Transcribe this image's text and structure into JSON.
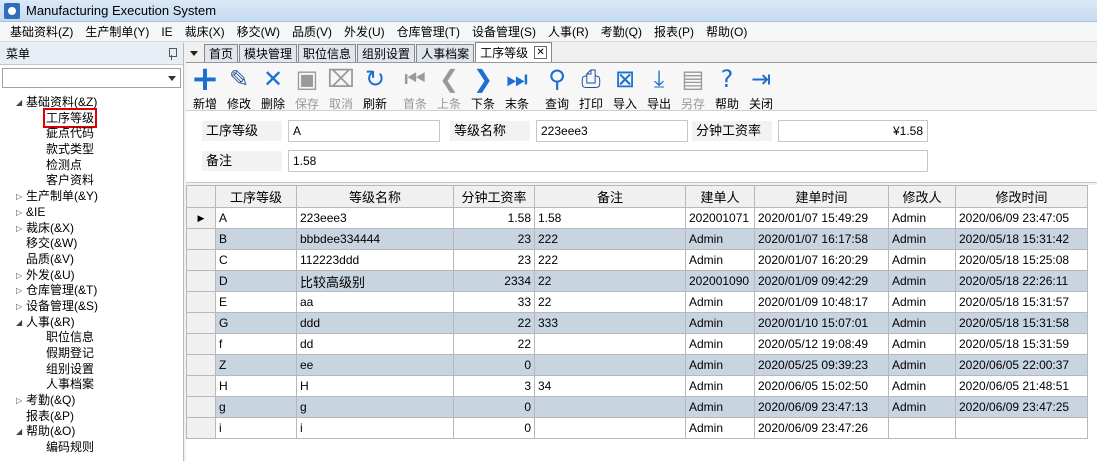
{
  "window": {
    "title": "Manufacturing Execution System"
  },
  "menu": [
    "基础资料(Z)",
    "生产制单(Y)",
    "IE",
    "裁床(X)",
    "移交(W)",
    "品质(V)",
    "外发(U)",
    "仓库管理(T)",
    "设备管理(S)",
    "人事(R)",
    "考勤(Q)",
    "报表(P)",
    "帮助(O)"
  ],
  "sidebar": {
    "title": "菜单",
    "tree": [
      {
        "label": "基础资料(&Z)",
        "level": 0,
        "expander": "◢"
      },
      {
        "label": "工序等级",
        "level": 1,
        "selected": true
      },
      {
        "label": "疵点代码",
        "level": 1
      },
      {
        "label": "款式类型",
        "level": 1
      },
      {
        "label": "检测点",
        "level": 1
      },
      {
        "label": "客户资料",
        "level": 1
      },
      {
        "label": "生产制单(&Y)",
        "level": 0,
        "expander": "▷"
      },
      {
        "label": "&IE",
        "level": 0,
        "expander": "▷"
      },
      {
        "label": "裁床(&X)",
        "level": 0,
        "expander": "▷"
      },
      {
        "label": "移交(&W)",
        "level": 0,
        "expander": ""
      },
      {
        "label": "品质(&V)",
        "level": 0,
        "expander": ""
      },
      {
        "label": "外发(&U)",
        "level": 0,
        "expander": "▷"
      },
      {
        "label": "仓库管理(&T)",
        "level": 0,
        "expander": "▷"
      },
      {
        "label": "设备管理(&S)",
        "level": 0,
        "expander": "▷"
      },
      {
        "label": "人事(&R)",
        "level": 0,
        "expander": "◢"
      },
      {
        "label": "职位信息",
        "level": 1
      },
      {
        "label": "假期登记",
        "level": 1
      },
      {
        "label": "组别设置",
        "level": 1
      },
      {
        "label": "人事档案",
        "level": 1
      },
      {
        "label": "考勤(&Q)",
        "level": 0,
        "expander": "▷"
      },
      {
        "label": "报表(&P)",
        "level": 0,
        "expander": ""
      },
      {
        "label": "帮助(&O)",
        "level": 0,
        "expander": "◢"
      },
      {
        "label": "编码规则",
        "level": 1
      }
    ]
  },
  "tabs": [
    {
      "label": "首页",
      "active": false
    },
    {
      "label": "模块管理",
      "active": false
    },
    {
      "label": "职位信息",
      "active": false
    },
    {
      "label": "组别设置",
      "active": false
    },
    {
      "label": "人事档案",
      "active": false
    },
    {
      "label": "工序等级",
      "active": true
    }
  ],
  "toolbar": [
    {
      "name": "add",
      "label": "新增",
      "glyph": "+",
      "color": "#1a6fd0",
      "disabled": false
    },
    {
      "name": "edit",
      "label": "修改",
      "glyph": "✎",
      "color": "#3060a0",
      "disabled": false
    },
    {
      "name": "delete",
      "label": "删除",
      "glyph": "✕",
      "color": "#1a6fd0",
      "disabled": false
    },
    {
      "name": "save",
      "label": "保存",
      "glyph": "▣",
      "color": "#999999",
      "disabled": true
    },
    {
      "name": "cancel",
      "label": "取消",
      "glyph": "⌧",
      "color": "#999999",
      "disabled": true
    },
    {
      "name": "refresh",
      "label": "刷新",
      "glyph": "↻",
      "color": "#1a6fd0",
      "disabled": false
    },
    {
      "name": "first",
      "label": "首条",
      "glyph": "⏮",
      "color": "#999999",
      "disabled": true
    },
    {
      "name": "prev",
      "label": "上条",
      "glyph": "❮",
      "color": "#999999",
      "disabled": true
    },
    {
      "name": "next",
      "label": "下条",
      "glyph": "❯",
      "color": "#1a6fd0",
      "disabled": false
    },
    {
      "name": "last",
      "label": "末条",
      "glyph": "⏭",
      "color": "#1a6fd0",
      "disabled": false
    },
    {
      "name": "query",
      "label": "查询",
      "glyph": "⚲",
      "color": "#1a6fd0",
      "disabled": false
    },
    {
      "name": "print",
      "label": "打印",
      "glyph": "⎙",
      "color": "#1a4f9a",
      "disabled": false
    },
    {
      "name": "import",
      "label": "导入",
      "glyph": "⊠",
      "color": "#1a6fd0",
      "disabled": false
    },
    {
      "name": "export",
      "label": "导出",
      "glyph": "⤓",
      "color": "#1a6fd0",
      "disabled": false
    },
    {
      "name": "saveas",
      "label": "另存",
      "glyph": "▤",
      "color": "#999999",
      "disabled": true
    },
    {
      "name": "help",
      "label": "帮助",
      "glyph": "?",
      "color": "#1a6fd0",
      "disabled": false
    },
    {
      "name": "close",
      "label": "关闭",
      "glyph": "⇥",
      "color": "#1a6fd0",
      "disabled": false
    }
  ],
  "form": {
    "grade_label": "工序等级",
    "grade_value": "A",
    "name_label": "等级名称",
    "name_value": "223eee3",
    "wage_label": "分钟工资率",
    "wage_value": "¥1.58",
    "remark_label": "备注",
    "remark_value": "1.58"
  },
  "grid": {
    "columns": [
      "工序等级",
      "等级名称",
      "分钟工资率",
      "备注",
      "建单人",
      "建单时间",
      "修改人",
      "修改时间"
    ],
    "rows": [
      [
        "A",
        "223eee3",
        "1.58",
        "1.58",
        "202001071",
        "2020/01/07 15:49:29",
        "Admin",
        "2020/06/09 23:47:05"
      ],
      [
        "B",
        "bbbdee334444",
        "23",
        "222",
        "Admin",
        "2020/01/07 16:17:58",
        "Admin",
        "2020/05/18 15:31:42"
      ],
      [
        "C",
        "112223ddd",
        "23",
        "222",
        "Admin",
        "2020/01/07 16:20:29",
        "Admin",
        "2020/05/18 15:25:08"
      ],
      [
        "D",
        "比较高级别",
        "2334",
        "22",
        "202001090",
        "2020/01/09 09:42:29",
        "Admin",
        "2020/05/18 22:26:11"
      ],
      [
        "E",
        "aa",
        "33",
        "22",
        "Admin",
        "2020/01/09 10:48:17",
        "Admin",
        "2020/05/18 15:31:57"
      ],
      [
        "G",
        "ddd",
        "22",
        "333",
        "Admin",
        "2020/01/10 15:07:01",
        "Admin",
        "2020/05/18 15:31:58"
      ],
      [
        "f",
        "dd",
        "22",
        "",
        "Admin",
        "2020/05/12 19:08:49",
        "Admin",
        "2020/05/18 15:31:59"
      ],
      [
        "Z",
        "ee",
        "0",
        "",
        "Admin",
        "2020/05/25 09:39:23",
        "Admin",
        "2020/06/05 22:00:37"
      ],
      [
        "H",
        "H",
        "3",
        "34",
        "Admin",
        "2020/06/05 15:02:50",
        "Admin",
        "2020/06/05 21:48:51"
      ],
      [
        "g",
        "g",
        "0",
        "",
        "Admin",
        "2020/06/09 23:47:13",
        "Admin",
        "2020/06/09 23:47:25"
      ],
      [
        "i",
        "i",
        "0",
        "",
        "Admin",
        "2020/06/09 23:47:26",
        "",
        ""
      ]
    ],
    "current_row_marker": "▶"
  }
}
